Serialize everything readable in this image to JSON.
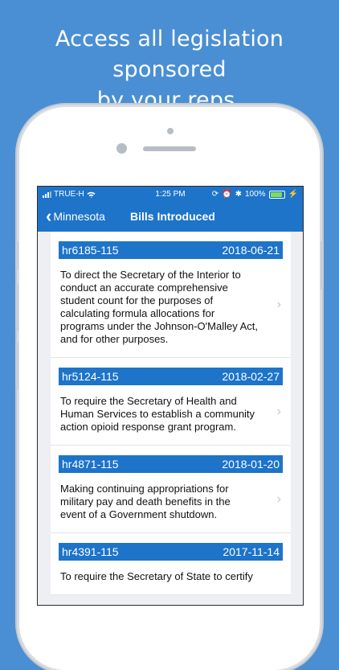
{
  "headline": {
    "line1": "Access all legislation sponsored",
    "line2": "by your reps."
  },
  "status_bar": {
    "carrier": "TRUE-H",
    "time": "1:25 PM",
    "battery": "100%",
    "icons": [
      "signal-bars-icon",
      "wifi-icon",
      "lock-rotation-icon",
      "alarm-icon",
      "bluetooth-icon",
      "battery-icon",
      "charging-icon"
    ]
  },
  "nav": {
    "back_label": "Minnesota",
    "title": "Bills Introduced"
  },
  "bills": [
    {
      "id": "hr6185-115",
      "date": "2018-06-21",
      "title": "To direct the Secretary of the Interior to conduct an accurate comprehensive student count for the purposes of calculating formula allocations for programs under the Johnson-O'Malley Act, and for other purposes."
    },
    {
      "id": "hr5124-115",
      "date": "2018-02-27",
      "title": "To require the Secretary of Health and Human Services to establish a community action opioid response grant program."
    },
    {
      "id": "hr4871-115",
      "date": "2018-01-20",
      "title": "Making continuing appropriations for military pay and death benefits in the event of a Government shutdown."
    },
    {
      "id": "hr4391-115",
      "date": "2017-11-14",
      "title": "To require the Secretary of State to certify"
    }
  ],
  "colors": {
    "background": "#4a8fd4",
    "brand_blue": "#1d74c9",
    "list_bg": "#eeeff3"
  }
}
